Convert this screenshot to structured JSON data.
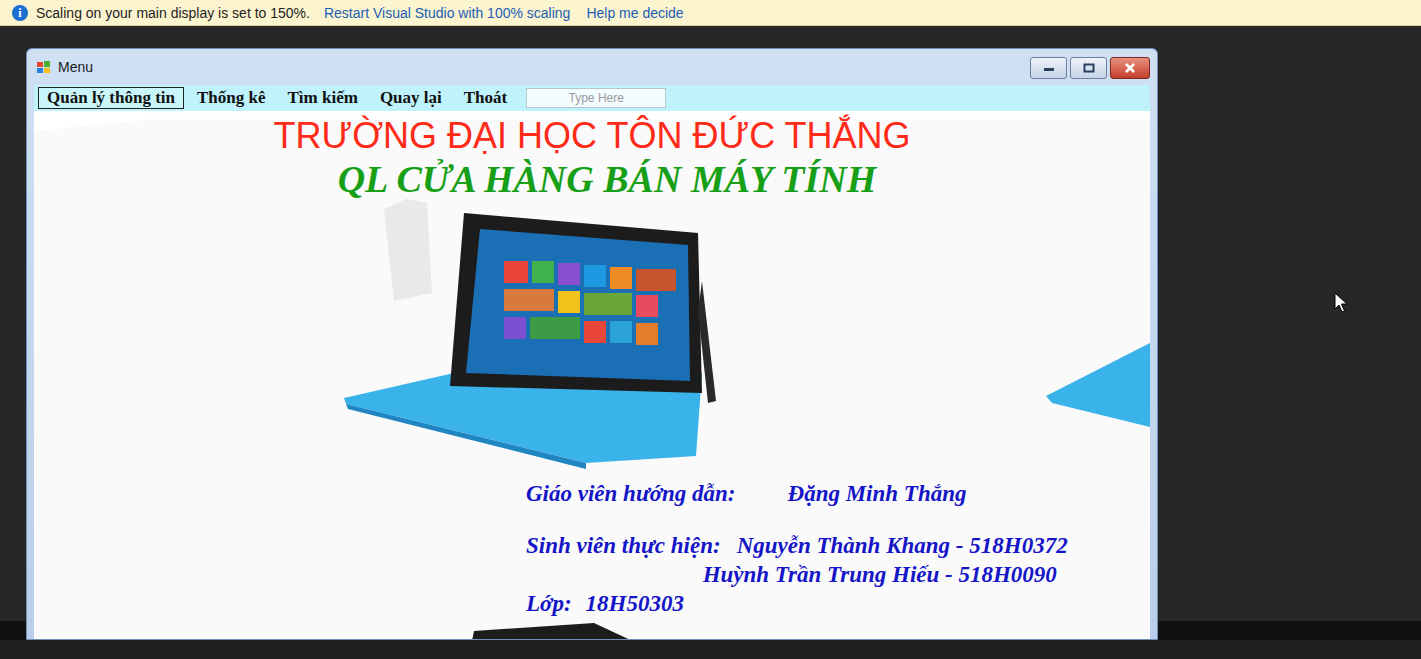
{
  "infobar": {
    "icon": "i",
    "message": "Scaling on your main display is set to 150%.",
    "links": [
      "Restart Visual Studio with 100% scaling",
      "Help me decide"
    ]
  },
  "window": {
    "title": "Menu"
  },
  "menu": {
    "items": [
      {
        "label": "Quản lý thông tin",
        "selected": true
      },
      {
        "label": "Thống kê",
        "selected": false
      },
      {
        "label": "Tìm kiếm",
        "selected": false
      },
      {
        "label": "Quay lại",
        "selected": false
      },
      {
        "label": "Thoát",
        "selected": false
      }
    ],
    "new_item": "Type Here"
  },
  "content": {
    "school": "TRƯỜNG ĐẠI HỌC TÔN ĐỨC THẮNG",
    "project": "QL CỬA HÀNG BÁN MÁY TÍNH",
    "credits": [
      {
        "label": "Giáo viên hướng dẫn:",
        "values": [
          "Đặng Minh Thắng"
        ]
      },
      {
        "label": "Sinh viên thực hiện:",
        "values": [
          "Nguyễn Thành Khang - 518H0372",
          "Huỳnh Trần Trung Hiếu - 518H0090"
        ]
      },
      {
        "label": "Lớp:",
        "values": [
          "18H50303"
        ]
      }
    ]
  }
}
